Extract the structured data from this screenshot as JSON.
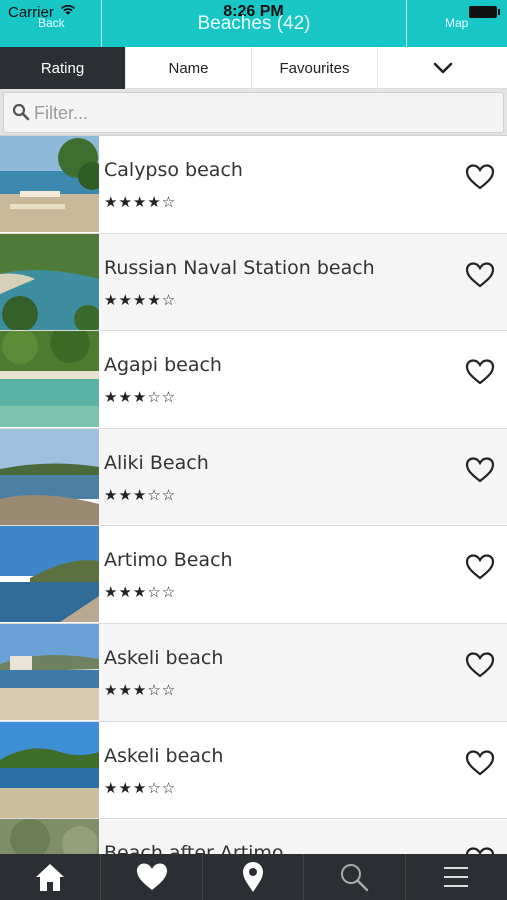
{
  "status": {
    "carrier": "Carrier",
    "time": "8:26 PM"
  },
  "header": {
    "back_label": "Back",
    "title": "Beaches (42)",
    "map_label": "Map"
  },
  "sort_tabs": [
    {
      "label": "Rating",
      "active": true
    },
    {
      "label": "Name",
      "active": false
    },
    {
      "label": "Favourites",
      "active": false
    }
  ],
  "sort_dropdown_icon": "chevron-down-icon",
  "filter": {
    "placeholder": "Filter...",
    "value": ""
  },
  "beaches": [
    {
      "name": "Calypso beach",
      "stars": "★★★★☆"
    },
    {
      "name": "Russian Naval Station beach",
      "stars": "★★★★☆"
    },
    {
      "name": "Agapi beach",
      "stars": "★★★☆☆"
    },
    {
      "name": "Aliki Beach",
      "stars": "★★★☆☆"
    },
    {
      "name": "Artimo Beach",
      "stars": "★★★☆☆"
    },
    {
      "name": "Askeli beach",
      "stars": "★★★☆☆"
    },
    {
      "name": "Askeli beach",
      "stars": "★★★☆☆"
    },
    {
      "name": "Beach after Artimo",
      "stars": "★★★☆☆"
    }
  ],
  "tabbar": [
    "home-icon",
    "heart-icon",
    "map-pin-icon",
    "search-icon",
    "menu-icon"
  ],
  "colors": {
    "accent": "#19c6c6",
    "dark": "#2b2f33"
  }
}
